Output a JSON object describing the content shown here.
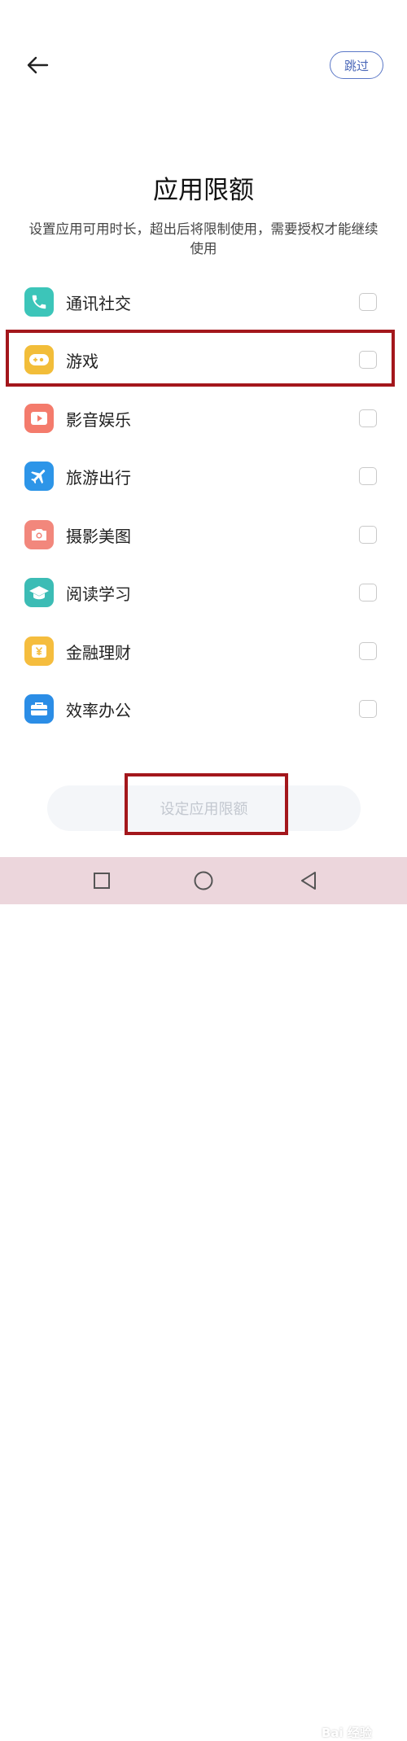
{
  "header": {
    "skip_label": "跳过"
  },
  "page": {
    "title": "应用限额",
    "description": "设置应用可用时长，超出后将限制使用，需要授权才能继续使用"
  },
  "categories": [
    {
      "label": "通讯社交",
      "icon": "phone-icon",
      "color": "#3cc5b9",
      "checked": false
    },
    {
      "label": "游戏",
      "icon": "gamepad-icon",
      "color": "#f2bd39",
      "checked": false
    },
    {
      "label": "影音娱乐",
      "icon": "play-icon",
      "color": "#f47b6c",
      "checked": false
    },
    {
      "label": "旅游出行",
      "icon": "airplane-icon",
      "color": "#2d95e8",
      "checked": false
    },
    {
      "label": "摄影美图",
      "icon": "camera-icon",
      "color": "#f2877c",
      "checked": false
    },
    {
      "label": "阅读学习",
      "icon": "graduation-cap-icon",
      "color": "#3cbcb5",
      "checked": false
    },
    {
      "label": "金融理财",
      "icon": "yuan-icon",
      "color": "#f5bd3e",
      "checked": false
    },
    {
      "label": "效率办公",
      "icon": "briefcase-icon",
      "color": "#2b8de6",
      "checked": false
    }
  ],
  "footer": {
    "confirm_label": "设定应用限额"
  },
  "watermark": "Bai 经验",
  "colors": {
    "accent": "#4a67b8",
    "annotation_red": "#a3171c",
    "navbar_bg": "#ecd6dc"
  }
}
